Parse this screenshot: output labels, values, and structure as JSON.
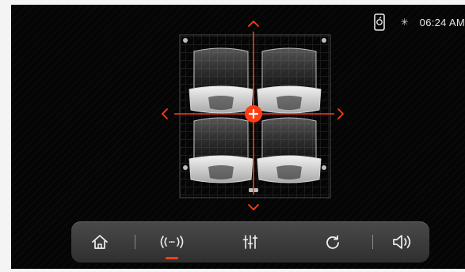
{
  "status_bar": {
    "time": "06:24 AM",
    "phone_icon": "phone-connected-icon",
    "bluetooth_icon": "bluetooth-icon"
  },
  "fader_balance": {
    "center_icon": "plus-icon",
    "arrows": [
      "arrow-up-icon",
      "arrow-down-icon",
      "arrow-left-icon",
      "arrow-right-icon"
    ],
    "seats": [
      "front-left-seat",
      "front-right-seat",
      "rear-left-seat",
      "rear-right-seat"
    ],
    "speakers": [
      "speaker-front-left",
      "speaker-front-right",
      "speaker-rear-left",
      "speaker-rear-right",
      "speaker-rear-center"
    ]
  },
  "nav_bar": {
    "items": [
      {
        "icon": "home-icon",
        "active": false
      },
      {
        "icon": "surround-sound-icon",
        "active": true
      },
      {
        "icon": "equalizer-icon",
        "active": false
      },
      {
        "icon": "reset-icon",
        "active": false
      },
      {
        "icon": "volume-icon",
        "active": false
      }
    ]
  },
  "colors": {
    "accent": "#ff3d14",
    "background": "#050505",
    "grid_line": "#3a3a3a",
    "text": "#e6e6e6"
  }
}
